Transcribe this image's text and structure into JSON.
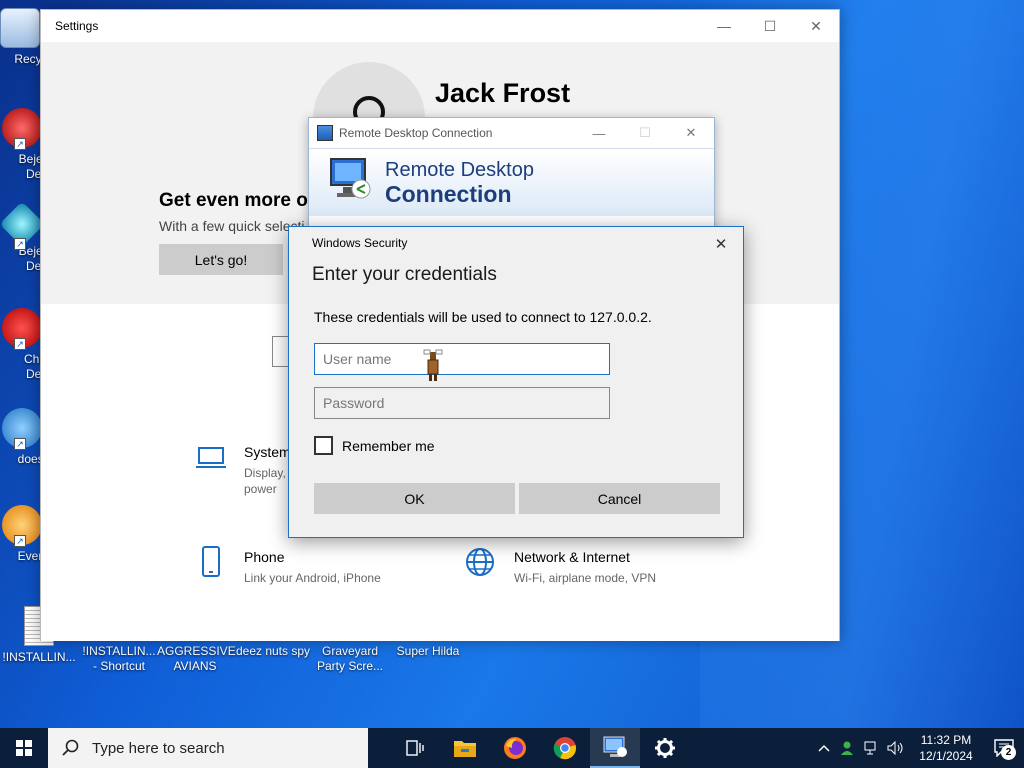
{
  "desktop": {
    "icons_left": [
      {
        "label": "Recyc"
      },
      {
        "label": "Bejew\nDel"
      },
      {
        "label": "Bejew\nDel"
      },
      {
        "label": "Chu\nDel"
      },
      {
        "label": "doesn"
      },
      {
        "label": "Every"
      }
    ],
    "icons_bottom": [
      {
        "label": "!INSTALLIN..."
      },
      {
        "label": "!INSTALLIN...\n- Shortcut"
      },
      {
        "label": "AGGRESSIVE\nAVIANS"
      },
      {
        "label": "deez nuts spy"
      },
      {
        "label": "Graveyard\nParty Scre..."
      },
      {
        "label": "Super Hilda"
      }
    ]
  },
  "settings": {
    "title": "Settings",
    "user_name": "Jack Frost",
    "promo_title": "Get even more o",
    "promo_sub": "With a few quick selecti",
    "cta_label": "Let's go!",
    "categories": [
      {
        "name": "System",
        "desc": "Display,\npower"
      },
      {
        "name": "Phone",
        "desc": "Link your Android, iPhone"
      },
      {
        "name": "Network & Internet",
        "desc": "Wi-Fi, airplane mode, VPN"
      }
    ]
  },
  "rdc": {
    "title": "Remote Desktop Connection",
    "banner_line1": "Remote Desktop",
    "banner_line2": "Connection"
  },
  "security": {
    "title": "Windows Security",
    "heading": "Enter your credentials",
    "info": "These credentials will be used to connect to 127.0.0.2.",
    "username_placeholder": "User name",
    "password_placeholder": "Password",
    "remember_label": "Remember me",
    "ok_label": "OK",
    "cancel_label": "Cancel"
  },
  "taskbar": {
    "search_placeholder": "Type here to search",
    "time": "11:32 PM",
    "date": "12/1/2024",
    "notification_count": "2",
    "apps": [
      "task-view-icon",
      "file-explorer-icon",
      "firefox-icon",
      "chrome-icon",
      "remote-desktop-icon",
      "settings-icon"
    ]
  }
}
